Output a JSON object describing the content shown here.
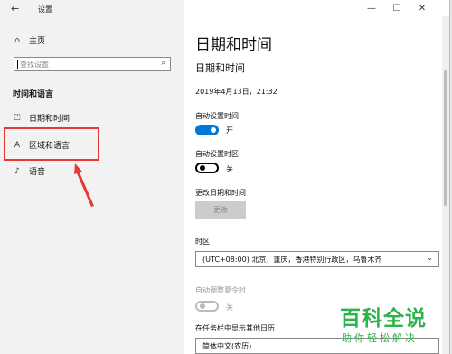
{
  "app": {
    "title": "设置",
    "back": "←"
  },
  "window_controls": {
    "minimize": "—",
    "maximize": "☐",
    "close": "✕"
  },
  "sidebar": {
    "home_label": "主页",
    "search_placeholder": "查找设置",
    "section_title": "时间和语言",
    "items": [
      {
        "label": "日期和时间",
        "icon": "calendar-clock-icon",
        "glyph": "⏍"
      },
      {
        "label": "区域和语言",
        "icon": "language-icon",
        "glyph": "A"
      },
      {
        "label": "语音",
        "icon": "microphone-icon",
        "glyph": "♪"
      }
    ]
  },
  "main": {
    "page_title": "日期和时间",
    "section_title": "日期和时间",
    "current_datetime": "2019年4月13日，21:32",
    "auto_time": {
      "label": "自动设置时间",
      "state": "开",
      "on": true
    },
    "auto_timezone": {
      "label": "自动设置时区",
      "state": "关",
      "on": false
    },
    "change_datetime": {
      "label": "更改日期和时间",
      "button": "更改"
    },
    "timezone": {
      "label": "时区",
      "value": "(UTC+08:00) 北京，重庆，香港特别行政区，乌鲁木齐"
    },
    "dst": {
      "label": "自动调整夏令时",
      "state": "关",
      "enabled": false
    },
    "taskbar_calendar": {
      "label": "在任务栏中显示其他日历",
      "value": "简体中文(农历)"
    }
  },
  "watermark": {
    "title": "百科全说",
    "subtitle": "助你轻松解决"
  },
  "colors": {
    "accent": "#0078d7",
    "highlight": "#e53935",
    "watermark": "#2cb34a"
  }
}
